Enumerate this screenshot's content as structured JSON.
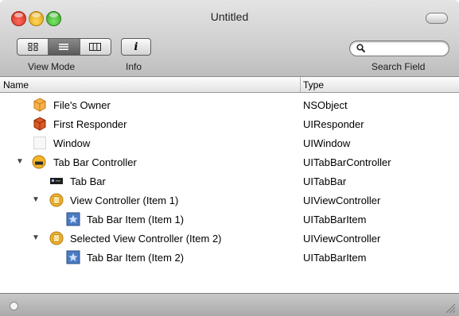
{
  "window": {
    "title": "Untitled"
  },
  "toolbar": {
    "view_mode_label": "View Mode",
    "view_modes": [
      "icon-view",
      "list-view",
      "column-view"
    ],
    "selected_view_mode": "list-view",
    "info_label": "Info",
    "info_glyph": "i",
    "search_label": "Search Field",
    "search_value": ""
  },
  "columns": {
    "name": "Name",
    "type": "Type"
  },
  "rows": [
    {
      "name": "File's Owner",
      "type": "NSObject",
      "depth": 0,
      "icon": "cube-icon",
      "disclosure": "none"
    },
    {
      "name": "First Responder",
      "type": "UIResponder",
      "depth": 0,
      "icon": "red-cube-icon",
      "disclosure": "none"
    },
    {
      "name": "Window",
      "type": "UIWindow",
      "depth": 0,
      "icon": "window-icon",
      "disclosure": "none"
    },
    {
      "name": "Tab Bar Controller",
      "type": "UITabBarController",
      "depth": 0,
      "icon": "tab-bar-controller-icon",
      "disclosure": "expanded"
    },
    {
      "name": "Tab Bar",
      "type": "UITabBar",
      "depth": 1,
      "icon": "tab-bar-icon",
      "disclosure": "none"
    },
    {
      "name": "View Controller (Item 1)",
      "type": "UIViewController",
      "depth": 1,
      "icon": "view-controller-icon",
      "disclosure": "expanded"
    },
    {
      "name": "Tab Bar Item (Item 1)",
      "type": "UITabBarItem",
      "depth": 2,
      "icon": "tab-bar-item-icon",
      "disclosure": "none"
    },
    {
      "name": "Selected View Controller (Item 2)",
      "type": "UIViewController",
      "depth": 1,
      "icon": "view-controller-icon",
      "disclosure": "expanded"
    },
    {
      "name": "Tab Bar Item (Item 2)",
      "type": "UITabBarItem",
      "depth": 2,
      "icon": "tab-bar-item-icon",
      "disclosure": "none"
    }
  ],
  "colors": {
    "close": "#c6261a",
    "minimize": "#d39a0c",
    "zoom": "#2f9e1e",
    "cube_orange": "#f4a23a",
    "cube_red": "#c8421a",
    "controller_yellow": "#f3b52a",
    "item_blue": "#3d6fb5"
  }
}
